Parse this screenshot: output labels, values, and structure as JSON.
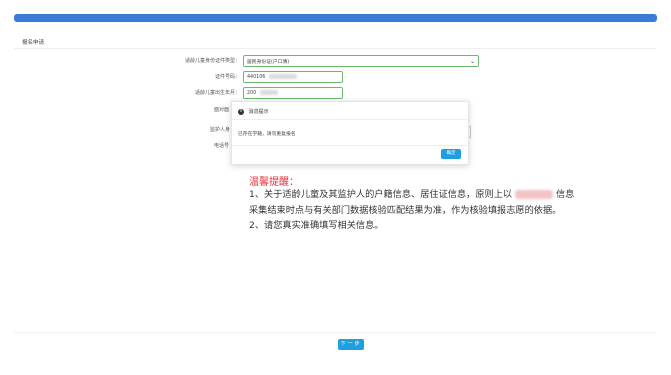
{
  "section": {
    "title": "报名申请"
  },
  "form": {
    "id_type_label": "适龄儿童身份证件类型：",
    "id_type_value": "居民身份证(户口簿)",
    "id_number_label": "证件号码：",
    "id_number_value": "440106",
    "birth_label": "适龄儿童出生年月：",
    "birth_value": "200",
    "hidden_label_1": "面对面",
    "hidden_label_2": "监护人身",
    "hidden_label_3": "电话号"
  },
  "dialog": {
    "title": "消息提示",
    "message": "已存在学籍，请勿重复报名",
    "confirm_label": "确定"
  },
  "notice": {
    "title": "温馨提醒：",
    "line1_a": "1、关于适龄儿童及其监护人的户籍信息、居住证信息，原则上以",
    "line1_b": "信息采集结束时点与有关部门数据核验匹配结果为准，作为核验填报志愿的依据。",
    "line2": "2、请您真实准确填写相关信息。"
  },
  "footer": {
    "next_label": "下一步"
  },
  "colors": {
    "accent": "#1e9fe0",
    "header_bar": "#3a7bd5",
    "notice_title": "#e8323b",
    "input_border": "#6bb96b"
  }
}
